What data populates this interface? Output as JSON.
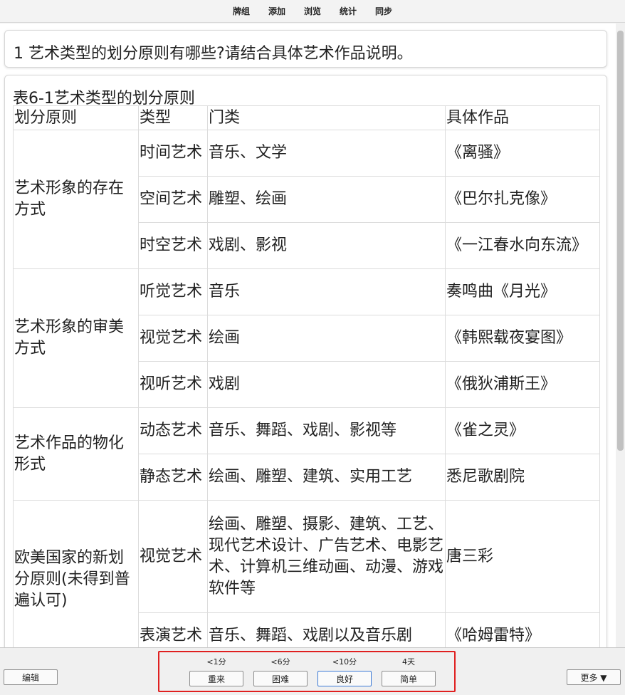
{
  "topbar": {
    "items": [
      "牌组",
      "添加",
      "浏览",
      "统计",
      "同步"
    ]
  },
  "question": "1 艺术类型的划分原则有哪些?请结合具体艺术作品说明。",
  "table": {
    "caption": "表6-1艺术类型的划分原则",
    "headers": [
      "划分原则",
      "类型",
      "门类",
      "具体作品"
    ],
    "groups": [
      {
        "principle": "艺术形象的存在方式",
        "rows": [
          {
            "type": "时间艺术",
            "category": "音乐、文学",
            "work": "《离骚》"
          },
          {
            "type": "空间艺术",
            "category": "雕塑、绘画",
            "work": "《巴尔扎克像》"
          },
          {
            "type": "时空艺术",
            "category": "戏剧、影视",
            "work": "《一江春水向东流》"
          }
        ]
      },
      {
        "principle": "艺术形象的审美方式",
        "rows": [
          {
            "type": "听觉艺术",
            "category": "音乐",
            "work": "奏鸣曲《月光》"
          },
          {
            "type": "视觉艺术",
            "category": "绘画",
            "work": "《韩熙载夜宴图》"
          },
          {
            "type": "视听艺术",
            "category": "戏剧",
            "work": "《俄狄浦斯王》"
          }
        ]
      },
      {
        "principle": "艺术作品的物化形式",
        "rows": [
          {
            "type": "动态艺术",
            "category": "音乐、舞蹈、戏剧、影视等",
            "work": "《雀之灵》"
          },
          {
            "type": "静态艺术",
            "category": "绘画、雕塑、建筑、实用工艺",
            "work": "悉尼歌剧院"
          }
        ]
      },
      {
        "principle": "欧美国家的新划分原则(未得到普遍认可)",
        "rows": [
          {
            "type": "视觉艺术",
            "category": "绘画、雕塑、摄影、建筑、工艺、现代艺术设计、广告艺术、电影艺术、计算机三维动画、动漫、游戏软件等",
            "work": "唐三彩"
          },
          {
            "type": "表演艺术",
            "category": "音乐、舞蹈、戏剧以及音乐剧",
            "work": "《哈姆雷特》"
          }
        ]
      }
    ]
  },
  "bottombar": {
    "edit_label": "编辑",
    "more_label": "更多 ▼",
    "answers": [
      {
        "interval": "<1分",
        "label": "重来"
      },
      {
        "interval": "<6分",
        "label": "困难"
      },
      {
        "interval": "<10分",
        "label": "良好"
      },
      {
        "interval": "4天",
        "label": "简单"
      }
    ]
  },
  "colors": {
    "highlight": "#e02020",
    "focus_border": "#3c7ad6"
  }
}
